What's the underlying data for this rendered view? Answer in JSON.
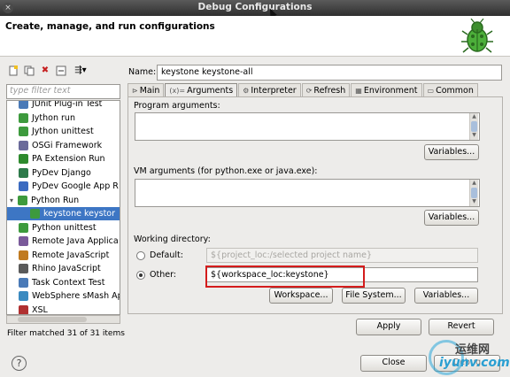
{
  "window": {
    "title": "Debug Configurations",
    "close_glyph": "×"
  },
  "header": {
    "text": "Create, manage, and run configurations"
  },
  "left": {
    "filter_placeholder": "type filter text",
    "tree": [
      {
        "label": "JUnit Plug-in Test",
        "icon": "junit-icon",
        "color": "#4a7ab7",
        "indent": 1
      },
      {
        "label": "Jython run",
        "icon": "jython-icon",
        "color": "#3d9a3d",
        "indent": 1
      },
      {
        "label": "Jython unittest",
        "icon": "jython-unittest-icon",
        "color": "#3d9a3d",
        "indent": 1
      },
      {
        "label": "OSGi Framework",
        "icon": "osgi-icon",
        "color": "#6a6a9a",
        "indent": 1
      },
      {
        "label": "PA Extension Run",
        "icon": "pa-icon",
        "color": "#2d8a2d",
        "indent": 1
      },
      {
        "label": "PyDev Django",
        "icon": "django-icon",
        "color": "#2d7a4a",
        "indent": 1
      },
      {
        "label": "PyDev Google App R",
        "icon": "google-app-icon",
        "color": "#3a6ac0",
        "indent": 1
      },
      {
        "label": "Python Run",
        "icon": "python-run-icon",
        "color": "#3d9a3d",
        "indent": 0,
        "expanded": true
      },
      {
        "label": "keystone keystor",
        "icon": "python-config-icon",
        "color": "#3d9a3d",
        "indent": 2,
        "selected": true
      },
      {
        "label": "Python unittest",
        "icon": "python-unittest-icon",
        "color": "#3d9a3d",
        "indent": 1
      },
      {
        "label": "Remote Java Applica",
        "icon": "remote-java-icon",
        "color": "#7a5a9a",
        "indent": 1
      },
      {
        "label": "Remote JavaScript",
        "icon": "remote-js-icon",
        "color": "#c07a20",
        "indent": 1
      },
      {
        "label": "Rhino JavaScript",
        "icon": "rhino-icon",
        "color": "#5a5a5a",
        "indent": 1
      },
      {
        "label": "Task Context Test",
        "icon": "task-context-icon",
        "color": "#4a7ab7",
        "indent": 1
      },
      {
        "label": "WebSphere sMash Ap",
        "icon": "websphere-icon",
        "color": "#3a8ac0",
        "indent": 1
      },
      {
        "label": "XSL",
        "icon": "xsl-icon",
        "color": "#b03030",
        "indent": 1
      }
    ],
    "status": "Filter matched 31 of 31 items"
  },
  "right": {
    "name_label": "Name:",
    "name_value": "keystone keystone-all",
    "tabs": [
      {
        "label": "Main",
        "icon": "main-tab-icon",
        "glyph": "⊳"
      },
      {
        "label": "Arguments",
        "icon": "arguments-tab-icon",
        "glyph": "(x)=",
        "active": true
      },
      {
        "label": "Interpreter",
        "icon": "interpreter-tab-icon",
        "glyph": "⚙"
      },
      {
        "label": "Refresh",
        "icon": "refresh-tab-icon",
        "glyph": "⟳"
      },
      {
        "label": "Environment",
        "icon": "environment-tab-icon",
        "glyph": "▦"
      },
      {
        "label": "Common",
        "icon": "common-tab-icon",
        "glyph": "▭"
      }
    ],
    "program_args_label": "Program arguments:",
    "vm_args_label": "VM arguments (for python.exe or java.exe):",
    "variables_label": "Variables...",
    "working_dir_label": "Working directory:",
    "default_label": "Default:",
    "default_value": "${project_loc:/selected project name}",
    "other_label": "Other:",
    "other_value": "${workspace_loc:keystone}",
    "workspace_button": "Workspace...",
    "filesystem_button": "File System...",
    "apply_button": "Apply",
    "revert_button": "Revert"
  },
  "footer": {
    "help_glyph": "?",
    "close_button": "Close",
    "debug_button": "Debug"
  },
  "watermark": {
    "top": "运维网",
    "bottom": "iyunv.com"
  }
}
